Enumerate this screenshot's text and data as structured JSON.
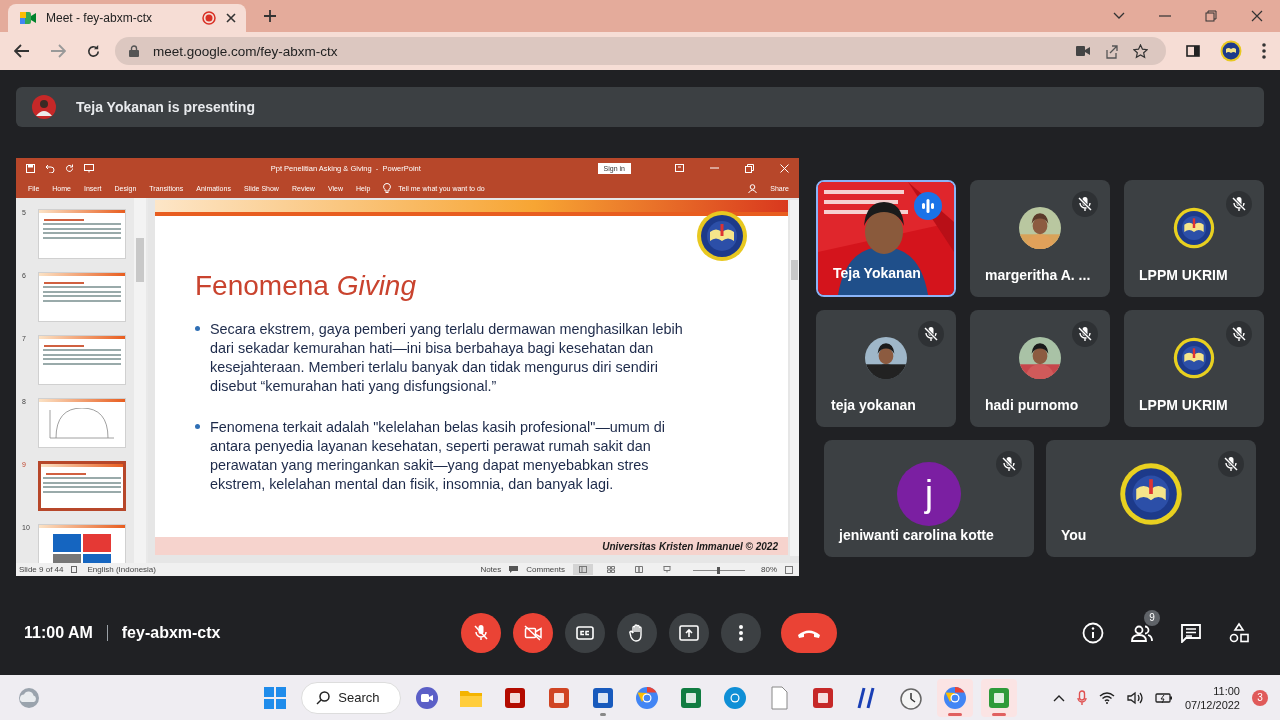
{
  "browser": {
    "tabs": [
      {
        "title": "Meet - fey-abxm-ctx",
        "selected": true,
        "recording": true
      }
    ],
    "url": "meet.google.com/fey-abxm-ctx"
  },
  "banner": {
    "text": "Teja Yokanan is presenting"
  },
  "presentation": {
    "title": "Ppt Penelitian Asking & Giving  -  PowerPoint",
    "sign_in": "Sign in",
    "menu": [
      "File",
      "Home",
      "Insert",
      "Design",
      "Transitions",
      "Animations",
      "Slide Show",
      "Review",
      "View",
      "Help"
    ],
    "tell_me": "Tell me what you want to do",
    "share": "Share",
    "thumbnails": [
      {
        "number": "5",
        "kind": "text",
        "selected": false
      },
      {
        "number": "6",
        "kind": "text",
        "selected": false
      },
      {
        "number": "7",
        "kind": "text",
        "selected": false
      },
      {
        "number": "8",
        "kind": "chart",
        "selected": false
      },
      {
        "number": "9",
        "kind": "text",
        "selected": true
      },
      {
        "number": "10",
        "kind": "blocks",
        "selected": false
      }
    ],
    "slide": {
      "title": "Fenomena *Giving*",
      "bullets": [
        "Secara ekstrem, gaya pemberi yang terlalu dermawan menghasilkan lebih dari sekadar kemurahan hati—ini bisa berbahaya bagi kesehatan dan kesejahteraan. Memberi terlalu banyak dan tidak mengurus diri sendiri disebut “kemurahan hati yang disfungsional.”",
        "Fenomena terkait adalah \"kelelahan belas kasih profesional\"—umum di antara penyedia layanan kesehatan, seperti perawat rumah sakit dan perawatan yang meringankan sakit—yang dapat menyebabkan stres ekstrem, kelelahan mental dan fisik, insomnia, dan banyak lagi."
      ],
      "footer": "Universitas Kristen Immanuel © 2022"
    },
    "status": {
      "slide_count": "Slide 9 of 44",
      "language": "English (Indonesia)",
      "notes": "Notes",
      "comments": "Comments",
      "zoom": "80%",
      "level": 0.5
    }
  },
  "tile_rows": [
    {
      "tiles": [
        {
          "name": "Teja Yokanan",
          "kind": "video",
          "speaking": true,
          "muted": false
        },
        {
          "name": "margeritha A. ...",
          "speaking": false,
          "muted": true
        },
        {
          "name": "LPPM UKRIM",
          "kind": "logo",
          "speaking": false,
          "muted": true
        }
      ]
    },
    {
      "tiles": [
        {
          "name": "teja yokanan",
          "speaking": false,
          "muted": true
        },
        {
          "name": "hadi purnomo",
          "speaking": false,
          "muted": true
        },
        {
          "name": "LPPM UKRIM",
          "kind": "logo",
          "speaking": false,
          "muted": true
        }
      ]
    },
    {
      "tiles": [
        {
          "name": "jeniwanti carolina kotte",
          "kind": "initial",
          "initial": "j",
          "speaking": false,
          "muted": true
        },
        {
          "name": "You",
          "kind": "logo",
          "speaking": false,
          "muted": true
        }
      ]
    }
  ],
  "meeting": {
    "time": "11:00 AM",
    "code": "fey-abxm-ctx",
    "participants": "9"
  },
  "controls": [
    {
      "kind": "mic",
      "off": true
    },
    {
      "kind": "camera",
      "off": true
    },
    {
      "kind": "captions",
      "off": false
    },
    {
      "kind": "hand",
      "off": false
    },
    {
      "kind": "present",
      "off": false
    },
    {
      "kind": "more",
      "off": false
    },
    {
      "kind": "leave"
    }
  ],
  "taskbar": {
    "search": "Search",
    "apps": [
      {
        "kind": "start",
        "open": false,
        "active": false
      },
      {
        "kind": "search"
      },
      {
        "kind": "videochat",
        "open": false,
        "active": false
      },
      {
        "kind": "folder",
        "open": false,
        "active": false
      },
      {
        "kind": "pdf",
        "open": false,
        "active": false
      },
      {
        "kind": "slides",
        "open": false,
        "active": false
      },
      {
        "kind": "docs",
        "open": true,
        "active": false
      },
      {
        "kind": "browser",
        "open": false,
        "active": false
      },
      {
        "kind": "sheet",
        "open": false,
        "active": false
      },
      {
        "kind": "browser2",
        "open": false,
        "active": false
      },
      {
        "kind": "file",
        "open": false,
        "active": false
      },
      {
        "kind": "stats",
        "open": false,
        "active": false
      },
      {
        "kind": "slash",
        "open": false,
        "active": false
      },
      {
        "kind": "clock",
        "open": false,
        "active": false
      },
      {
        "kind": "browser",
        "open": true,
        "active": true
      },
      {
        "kind": "green",
        "open": true,
        "active": true
      }
    ],
    "time": "11:00",
    "date": "07/12/2022",
    "notifications": "3"
  }
}
